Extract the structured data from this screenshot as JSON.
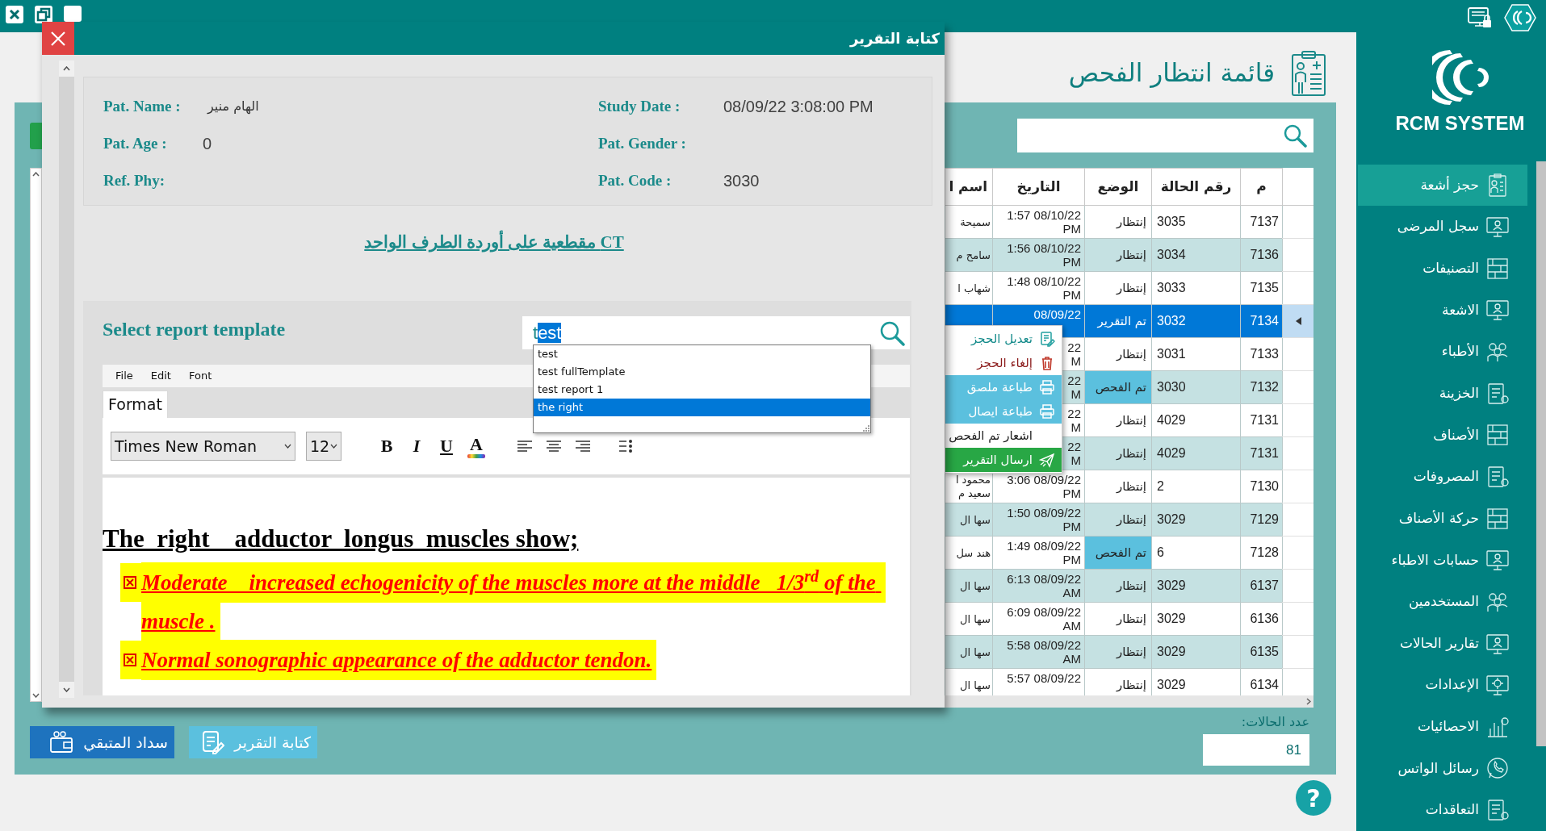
{
  "dialog": {
    "title": "كتابة التقرير",
    "patient": [
      {
        "label": "Pat. Name :",
        "value": "الهام منير",
        "kind": "arabic"
      },
      {
        "label": "Pat. Age :",
        "value": "0",
        "kind": "latin"
      },
      {
        "label": "Ref. Phy:"
      }
    ],
    "study": [
      {
        "label": "Study Date :",
        "value": "08/09/22 3:08:00 PM",
        "kind": "latin"
      },
      {
        "label": "Pat. Gender :"
      },
      {
        "label": "Pat. Code :",
        "value": "3030",
        "kind": "latin"
      }
    ],
    "exam_title": "CT مقطعية على أوردة الطرف الواحد",
    "template": {
      "label": "Select report template",
      "search": {
        "value": "t",
        "suggestion": "est"
      },
      "suggestions": [
        {
          "label": "test",
          "selected": false
        },
        {
          "label": "test fullTemplate",
          "selected": false
        },
        {
          "label": "test report 1",
          "selected": false
        },
        {
          "label": "the right",
          "selected": true
        }
      ]
    },
    "editor": {
      "menu": {
        "file": "File",
        "edit": "Edit",
        "font": "Font"
      },
      "tabs": [
        {
          "label": "Format",
          "selected": true
        }
      ],
      "font": "Times New Roman",
      "size": "12",
      "format_buttons": {
        "bold": "B",
        "italic": "I",
        "underline": "U",
        "font_color": "A"
      },
      "document": {
        "heading": "The  right    adductor  longus  muscles show;",
        "items": [
          "Moderate    increased echogenicity of the muscles more at the middle   1/3$^{rd}$ of the muscle .",
          "Normal sonographic appearance of the adductor tendon."
        ]
      }
    }
  },
  "page": {
    "title": "قائمة انتظار الفحص"
  },
  "table": {
    "columns": [
      "م",
      "رقم الحالة",
      "الوضع",
      "التاريخ",
      "اسم ا"
    ],
    "rows": [
      {
        "no": "7137",
        "case": "3035",
        "status": "إنتظار",
        "status_highlight": false,
        "date_lines": [
          "1:57 08/10/22",
          "PM"
        ],
        "name": "سميحة",
        "selected": false
      },
      {
        "no": "7136",
        "case": "3034",
        "status": "إنتظار",
        "status_highlight": false,
        "date_lines": [
          "1:56 08/10/22",
          "PM"
        ],
        "name": "سامح م",
        "selected": false
      },
      {
        "no": "7135",
        "case": "3033",
        "status": "إنتظار",
        "status_highlight": false,
        "date_lines": [
          "1:48 08/10/22",
          "PM"
        ],
        "name": "شهاب ا",
        "selected": false
      },
      {
        "no": "7134",
        "case": "3032",
        "status": "تم التقرير",
        "status_highlight": false,
        "date_lines": [
          "08/09/22"
        ],
        "selected": true
      },
      {
        "no": "7133",
        "case": "3031",
        "status": "إنتظار",
        "status_highlight": false,
        "date_lines": [
          "22",
          "M"
        ],
        "selected": false
      },
      {
        "no": "7132",
        "case": "3030",
        "status": "تم الفحص",
        "status_highlight": true,
        "date_lines": [
          "22",
          "M"
        ],
        "selected": false
      },
      {
        "no": "7131",
        "case": "4029",
        "status": "إنتظار",
        "status_highlight": false,
        "date_lines": [
          "22",
          "M"
        ],
        "selected": false
      },
      {
        "no": "7131",
        "case": "4029",
        "status": "إنتظار",
        "status_highlight": false,
        "date_lines": [
          "22",
          "M"
        ],
        "selected": false
      },
      {
        "no": "7130",
        "case": "2",
        "status": "إنتظار",
        "status_highlight": false,
        "date_lines": [
          "3:06 08/09/22",
          "PM"
        ],
        "name": "محمود ا سعيد م",
        "selected": false
      },
      {
        "no": "7129",
        "case": "3029",
        "status": "إنتظار",
        "status_highlight": false,
        "date_lines": [
          "1:50 08/09/22",
          "PM"
        ],
        "name": "سها ال",
        "selected": false
      },
      {
        "no": "7128",
        "case": "6",
        "status": "تم الفحص",
        "status_highlight": true,
        "date_lines": [
          "1:49 08/09/22",
          "PM"
        ],
        "name": "هند سل",
        "selected": false
      },
      {
        "no": "6137",
        "case": "3029",
        "status": "إنتظار",
        "status_highlight": false,
        "date_lines": [
          "6:13 08/09/22",
          "AM"
        ],
        "name": "سها ال",
        "selected": false
      },
      {
        "no": "6136",
        "case": "3029",
        "status": "إنتظار",
        "status_highlight": false,
        "date_lines": [
          "6:09 08/09/22",
          "AM"
        ],
        "name": "سها ال",
        "selected": false
      },
      {
        "no": "6135",
        "case": "3029",
        "status": "إنتظار",
        "status_highlight": false,
        "date_lines": [
          "5:58 08/09/22",
          "AM"
        ],
        "name": "سها ال",
        "selected": false
      },
      {
        "no": "6134",
        "case": "3029",
        "status": "إنتظار",
        "status_highlight": false,
        "date_lines": [
          "5:57 08/09/22"
        ],
        "name": "سها ال",
        "selected": false
      }
    ]
  },
  "context_menu": [
    {
      "label": "تعديل الحجز",
      "kind": "edit"
    },
    {
      "label": "إلغاء الحجز",
      "kind": "cancel"
    },
    {
      "label": "طباعة ملصق",
      "kind": "print"
    },
    {
      "label": "طباعة ايصال",
      "kind": "print"
    },
    {
      "label": "اشعار تم الفحص",
      "kind": "notify"
    },
    {
      "label": "ارسال التقرير",
      "kind": "send"
    }
  ],
  "case_count": {
    "label": "عدد الحالات:",
    "value": "81"
  },
  "buttons": [
    {
      "label": "كتابة التقرير",
      "kind": "secondary"
    },
    {
      "label": "سداد المتبقي",
      "kind": "primary"
    }
  ],
  "help": "?",
  "sidebar": {
    "brand": "RCM SYSTEM",
    "items": [
      {
        "label": "حجز أشعة",
        "selected": true
      },
      {
        "label": "سجل المرضى",
        "selected": false
      },
      {
        "label": "التصنيفات",
        "selected": false
      },
      {
        "label": "الاشعة",
        "selected": false
      },
      {
        "label": "الأطباء",
        "selected": false
      },
      {
        "label": "الخزينة",
        "selected": false
      },
      {
        "label": "الأصناف",
        "selected": false
      },
      {
        "label": "المصروفات",
        "selected": false
      },
      {
        "label": "حركة الأصناف",
        "selected": false
      },
      {
        "label": "حسابات الاطباء",
        "selected": false
      },
      {
        "label": "المستخدمين",
        "selected": false
      },
      {
        "label": "تقارير الحالات",
        "selected": false
      },
      {
        "label": "الإعدادات",
        "selected": false
      },
      {
        "label": "الاحصائيات",
        "selected": false
      },
      {
        "label": "رسائل الواتس",
        "selected": false
      },
      {
        "label": "التعاقدات",
        "selected": false
      }
    ]
  }
}
